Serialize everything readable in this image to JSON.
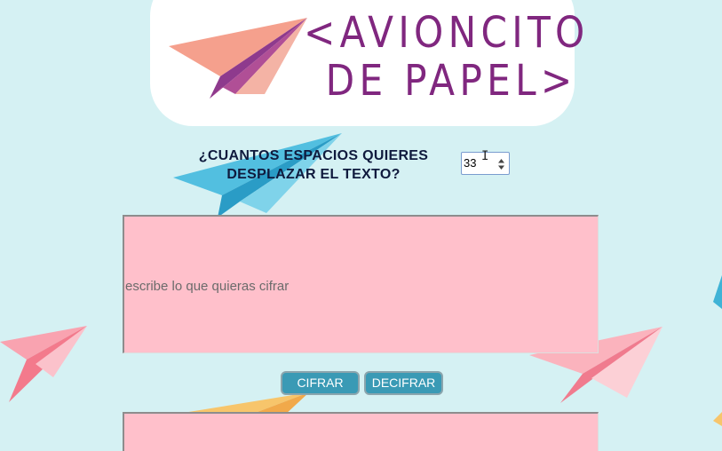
{
  "logo": {
    "line1": "<AVIONCITO",
    "line2": "DE PAPEL>",
    "icon": "paper-plane-icon"
  },
  "shift": {
    "question_line1": "¿CUANTOS ESPACIOS QUIERES",
    "question_line2": "DESPLAZAR EL TEXTO?",
    "value": "33"
  },
  "input_area": {
    "placeholder": "escribe lo que quieras cifrar",
    "value": ""
  },
  "buttons": {
    "encrypt_label": "CIFRAR",
    "decrypt_label": "DECIFRAR"
  },
  "output_area": {
    "value": ""
  },
  "colors": {
    "background": "#d5f1f3",
    "brand_purple": "#80277f",
    "textarea_pink": "#ffc0cb",
    "button_blue": "#3a9ab5"
  }
}
